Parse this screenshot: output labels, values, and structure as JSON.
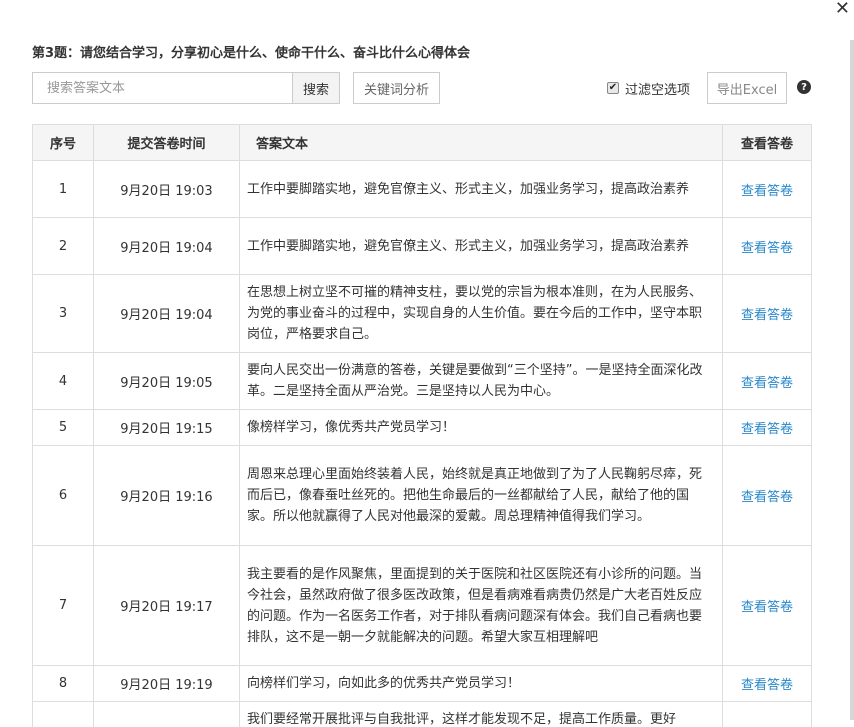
{
  "question_title": "第3题：请您结合学习，分享初心是什么、使命干什么、奋斗比什么心得体会",
  "search": {
    "placeholder": "搜索答案文本",
    "button_label": "搜索"
  },
  "keyword_button_label": "关键词分析",
  "filter_label": "过滤空选项",
  "filter_checked": true,
  "export_label": "导出Excel",
  "help_icon": "question-circle-icon",
  "close_icon": "close-icon",
  "columns": [
    "序号",
    "提交答卷时间",
    "答案文本",
    "查看答卷"
  ],
  "rows": [
    {
      "index": "1",
      "time": "9月20日 19:03",
      "text": "工作中要脚踏实地，避免官僚主义、形式主义，加强业务学习，提高政治素养",
      "link": "查看答卷"
    },
    {
      "index": "2",
      "time": "9月20日 19:04",
      "text": "工作中要脚踏实地，避免官僚主义、形式主义，加强业务学习，提高政治素养",
      "link": "查看答卷"
    },
    {
      "index": "3",
      "time": "9月20日 19:04",
      "text": "在思想上树立坚不可摧的精神支柱，要以党的宗旨为根本准则，在为人民服务、为党的事业奋斗的过程中，实现自身的人生价值。要在今后的工作中，坚守本职岗位，严格要求自己。",
      "link": "查看答卷"
    },
    {
      "index": "4",
      "time": "9月20日 19:05",
      "text": "要向人民交出一份满意的答卷，关键是要做到“三个坚持”。一是坚持全面深化改革。二是坚持全面从严治党。三是坚持以人民为中心。",
      "link": "查看答卷"
    },
    {
      "index": "5",
      "time": "9月20日 19:15",
      "text": "像榜样学习，像优秀共产党员学习！",
      "link": "查看答卷"
    },
    {
      "index": "6",
      "time": "9月20日 19:16",
      "text": "周恩来总理心里面始终装着人民，始终就是真正地做到了为了人民鞠躬尽瘁，死而后已，像春蚕吐丝死的。把他生命最后的一丝都献给了人民，献给了他的国家。所以他就赢得了人民对他最深的爱戴。周总理精神值得我们学习。",
      "link": "查看答卷"
    },
    {
      "index": "7",
      "time": "9月20日 19:17",
      "text": "我主要看的是作风聚焦，里面提到的关于医院和社区医院还有小诊所的问题。当今社会，虽然政府做了很多医改政策，但是看病难看病贵仍然是广大老百姓反应的问题。作为一名医务工作者，对于排队看病问题深有体会。我们自己看病也要排队，这不是一朝一夕就能解决的问题。希望大家互相理解吧",
      "link": "查看答卷"
    },
    {
      "index": "8",
      "time": "9月20日 19:19",
      "text": "向榜样们学习，向如此多的优秀共产党员学习！",
      "link": "查看答卷"
    },
    {
      "index": "",
      "time": "",
      "text": "我们要经常开展批评与自我批评，这样才能发现不足，提高工作质量。更好",
      "link": ""
    }
  ]
}
